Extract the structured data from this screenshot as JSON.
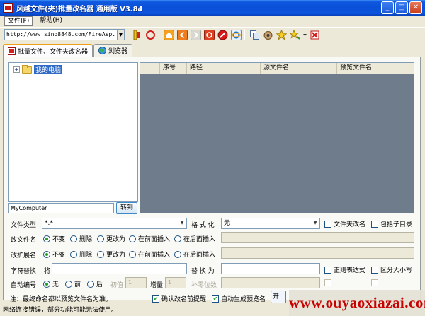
{
  "window": {
    "title": "风越文件(夹)批量改名器 通用版 V3.84",
    "buttons": {
      "minimize": "_",
      "maximize": "□",
      "close": "✕"
    }
  },
  "menu": [
    {
      "label": "文件(F)",
      "active": true
    },
    {
      "label": "帮助(H)",
      "active": false
    }
  ],
  "toolbar": {
    "url": "http://www.sino8848.com/FireAsp..."
  },
  "tabs": [
    {
      "label": "批量文件、文件夹改名器",
      "active": true
    },
    {
      "label": "浏览器",
      "active": false
    }
  ],
  "tree": {
    "root_label": "我的电脑",
    "expander": "+"
  },
  "path": {
    "value": "MyComputer",
    "goto_label": "转到"
  },
  "grid": {
    "columns": [
      "",
      "序号",
      "路径",
      "源文件名",
      "预览文件名"
    ]
  },
  "options": {
    "file_type_label": "文件类型",
    "file_type_value": "*.*",
    "format_label": "格 式 化",
    "format_value": "无",
    "folder_rename": "文件夹改名",
    "include_subdirs": "包括子目录",
    "rename_file_label": "改文件名",
    "rename_ext_label": "改扩展名",
    "radio_choices": [
      "不变",
      "删除",
      "更改为",
      "在前面插入",
      "在后面插入"
    ],
    "replace_label": "字符替换",
    "replace_from": "将",
    "replace_to": "替 换 为",
    "regex": "正则表达式",
    "case_sensitive": "区分大小写",
    "autonum_label": "自动编号",
    "autonum_choices": [
      "无",
      "前",
      "后"
    ],
    "start_label": "初值",
    "start_value": "1",
    "step_label": "增量",
    "step_value": "1",
    "pad_label": "补零位数",
    "confirm_rename": "确认改名前提醒",
    "auto_preview": "自动生成预览名",
    "rename_button_fragment": "开"
  },
  "note": "注：最终命名都以预览文件名为准。",
  "status": "网络连接错误，部分功能可能无法使用。",
  "watermark": "www.ouyaoxiazai.com"
}
